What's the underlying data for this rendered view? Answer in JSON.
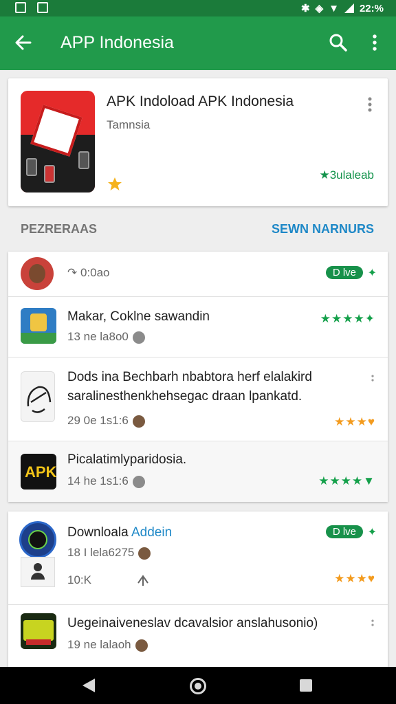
{
  "status_bar": {
    "time": "22:%"
  },
  "app_bar": {
    "title": "APP Indonesia"
  },
  "hero": {
    "title": "APK Indoload APK Indonesia",
    "developer": "Tamnsia",
    "rating_text": "★3ulaleab"
  },
  "section": {
    "title": "PEZRERAAS",
    "action": "SEWN NARNURS"
  },
  "list1": {
    "rows": [
      {
        "title": "",
        "subtitle": "↷ 0:0ao",
        "badge": "D lve",
        "spark": "✦"
      },
      {
        "title": "Makar, Coklne sawandin",
        "subtitle": "13 ne la8o0",
        "stars": "★★★★✦"
      },
      {
        "title": "Dods ina Bechbarh nbabtora herf elalakird",
        "title2": "saralinesthenkhehsegac draan lpankatd.",
        "subtitle": "29 0e 1s1:6",
        "stars": "★★★♥"
      },
      {
        "title": "Picalatimlyparidosia.",
        "subtitle": "14 he 1s1:6",
        "stars": "★★★★▼"
      }
    ]
  },
  "list2": {
    "rows": [
      {
        "title": "Downloala",
        "title_accent": "Addein",
        "subtitle": "18 I lela6275",
        "subtitle2": "10:K",
        "badge": "D lve",
        "spark": "✦",
        "stars": "★★★♥"
      },
      {
        "title": "Uegeinaiveneslav dcavalsior anslahusonio)",
        "subtitle": "19 ne lalaoh"
      }
    ]
  },
  "colors": {
    "status_bar": "#1b7b3a",
    "app_bar": "#219a4b",
    "accent_green": "#14a04a",
    "accent_blue": "#1e88c7",
    "star_orange": "#f39b1e"
  },
  "icons": [
    "back-arrow-icon",
    "search-icon",
    "more-vert-icon",
    "nav-back-icon",
    "nav-home-icon",
    "nav-recents-icon"
  ]
}
